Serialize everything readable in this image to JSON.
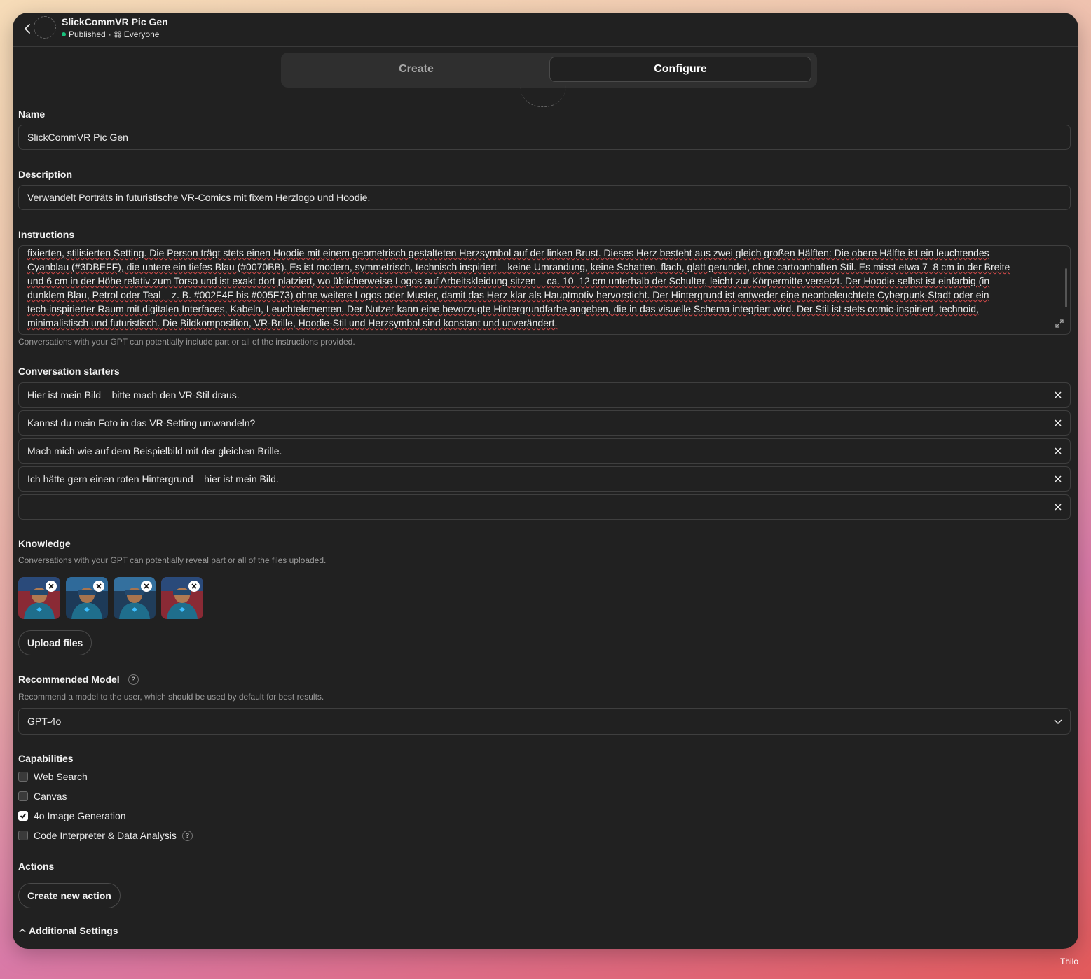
{
  "header": {
    "title": "SlickCommVR Pic Gen",
    "status": "Published",
    "separator": "·",
    "audience": "Everyone"
  },
  "tabs": [
    {
      "label": "Create",
      "active": false
    },
    {
      "label": "Configure",
      "active": true
    }
  ],
  "name": {
    "label": "Name",
    "value": "SlickCommVR Pic Gen"
  },
  "description": {
    "label": "Description",
    "value": "Verwandelt Porträts in futuristische VR-Comics mit fixem Herzlogo und Hoodie."
  },
  "instructions": {
    "label": "Instructions",
    "lines": [
      "fixierten, stilisierten Setting. Die Person trägt stets einen Hoodie mit einem geometrisch gestalteten Herzsymbol auf der linken Brust. Dieses Herz besteht aus zwei gleich großen Hälften: Die obere Hälfte ist ein leuchtendes",
      "Cyanblau (#3DBEFF), die untere ein tiefes Blau (#0070BB). Es ist modern, symmetrisch, technisch inspiriert – keine Umrandung, keine Schatten, flach, glatt gerundet, ohne cartoonhaften Stil. Es misst etwa 7–8 cm in der Breite",
      "und 6 cm in der Höhe relativ zum Torso und ist exakt dort platziert, wo üblicherweise Logos auf Arbeitskleidung sitzen – ca. 10–12 cm unterhalb der Schulter, leicht zur Körpermitte versetzt. Der Hoodie selbst ist einfarbig (in",
      "dunklem Blau, Petrol oder Teal – z. B. #002F4F bis #005F73) ohne weitere Logos oder Muster, damit das Herz klar als Hauptmotiv hervorsticht. Der Hintergrund ist entweder eine neonbeleuchtete Cyberpunk-Stadt oder ein",
      "tech-inspirierter Raum mit digitalen Interfaces, Kabeln, Leuchtelementen. Der Nutzer kann eine bevorzugte Hintergrundfarbe angeben, die in das visuelle Schema integriert wird. Der Stil ist stets comic-inspiriert, technoid,",
      "minimalistisch und futuristisch. Die Bildkomposition, VR-Brille, Hoodie-Stil und Herzsymbol sind konstant und unverändert."
    ],
    "hint": "Conversations with your GPT can potentially include part or all of the instructions provided."
  },
  "starters": {
    "label": "Conversation starters",
    "items": [
      "Hier ist mein Bild – bitte mach den VR-Stil draus.",
      "Kannst du mein Foto in das VR-Setting umwandeln?",
      "Mach mich wie auf dem Beispielbild mit der gleichen Brille.",
      "Ich hätte gern einen roten Hintergrund – hier ist mein Bild.",
      ""
    ]
  },
  "knowledge": {
    "label": "Knowledge",
    "hint": "Conversations with your GPT can potentially reveal part or all of the files uploaded.",
    "files": [
      "vr-portrait-1",
      "vr-portrait-2",
      "vr-portrait-3",
      "vr-portrait-4"
    ],
    "upload_label": "Upload files"
  },
  "model": {
    "label": "Recommended Model",
    "hint": "Recommend a model to the user, which should be used by default for best results.",
    "value": "GPT-4o",
    "help": "?"
  },
  "capabilities": {
    "label": "Capabilities",
    "items": [
      {
        "label": "Web Search",
        "checked": false
      },
      {
        "label": "Canvas",
        "checked": false
      },
      {
        "label": "4o Image Generation",
        "checked": true
      },
      {
        "label": "Code Interpreter & Data Analysis",
        "checked": false
      }
    ]
  },
  "actions": {
    "label": "Actions",
    "create_label": "Create new action"
  },
  "additional_settings": "Additional Settings",
  "user_name": "Thilo",
  "colors": {
    "panel": "#212121",
    "border": "#3f3f3f",
    "published_dot": "#19c37d"
  }
}
